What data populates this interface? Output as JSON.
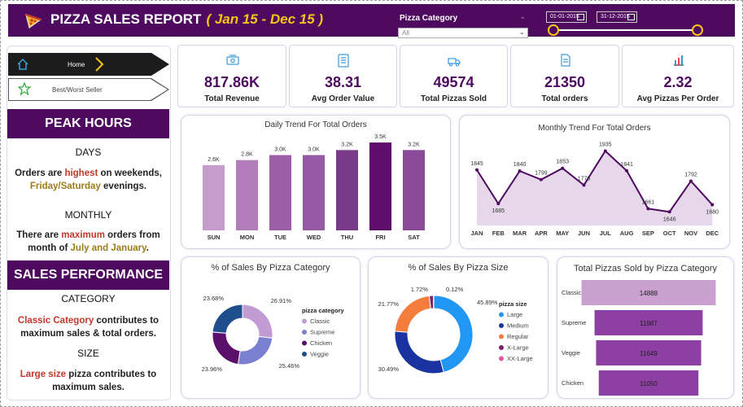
{
  "header": {
    "title": "PIZZA SALES REPORT",
    "range": "( Jan 15 - Dec 15 )",
    "filter_label": "Pizza Category",
    "filter_value": "All",
    "date_start": "01-01-2015",
    "date_end": "31-12-2015"
  },
  "nav": {
    "home": "Home",
    "best_worst": "Best/Worst Seller"
  },
  "peak": {
    "title": "PEAK HOURS",
    "days_title": "DAYS",
    "days_t1": "Orders are ",
    "days_hl": "highest",
    "days_t2": " on weekends,",
    "days_hl2": "Friday/Saturday",
    "days_t3": " evenings.",
    "month_title": "MONTHLY",
    "month_t1": "There are ",
    "month_hl": "maximum",
    "month_t2": " orders from",
    "month_t3": "month of ",
    "month_hl2": "July and January",
    "month_t4": "."
  },
  "sales": {
    "title": "SALES PERFORMANCE",
    "cat_title": "CATEGORY",
    "cat_hl": "Classic Category",
    "cat_t1": " contributes to",
    "cat_t2": "maximum sales & total orders.",
    "size_title": "SIZE",
    "size_hl": "Large size",
    "size_t1": " pizza contributes to",
    "size_t2": "maximum sales."
  },
  "kpis": [
    {
      "value": "817.86K",
      "label": "Total Revenue",
      "icon": "money-icon"
    },
    {
      "value": "38.31",
      "label": "Avg Order Value",
      "icon": "clipboard-icon"
    },
    {
      "value": "49574",
      "label": "Total Pizzas Sold",
      "icon": "delivery-icon"
    },
    {
      "value": "21350",
      "label": "Total orders",
      "icon": "document-icon"
    },
    {
      "value": "2.32",
      "label": "Avg Pizzas Per Order",
      "icon": "bar-chart-icon"
    }
  ],
  "colors": {
    "primary": "#4e0a5f",
    "accent": "#f5c518",
    "bar_colors": [
      "#c59ccb",
      "#b27cbb",
      "#9d5ea8",
      "#955aa3",
      "#7a3a8a",
      "#5e0f6d",
      "#8a4a97"
    ],
    "category_colors": [
      "#c39bd3",
      "#7b7fd0",
      "#5a0f6a",
      "#1f4e8c"
    ],
    "size_colors": [
      "#2196f3",
      "#1a33a0",
      "#f47c3c",
      "#7b1f6e",
      "#e056a5"
    ],
    "hbar_colors": [
      "#c9a0d0",
      "#8e3fa3",
      "#8e3fa3",
      "#8e3fa3"
    ]
  },
  "chart_data": [
    {
      "type": "bar",
      "title": "Daily Trend For Total Orders",
      "categories": [
        "SUN",
        "MON",
        "TUE",
        "WED",
        "THU",
        "FRI",
        "SAT"
      ],
      "values": [
        2.6,
        2.8,
        3.0,
        3.0,
        3.2,
        3.5,
        3.2
      ],
      "labels": [
        "2.6K",
        "2.8K",
        "3.0K",
        "3.0K",
        "3.2K",
        "3.5K",
        "3.2K"
      ],
      "ylim": [
        0,
        3.6
      ]
    },
    {
      "type": "area",
      "title": "Monthly Trend For Total Orders",
      "categories": [
        "JAN",
        "FEB",
        "MAR",
        "APR",
        "MAY",
        "JUN",
        "JUL",
        "AUG",
        "SEP",
        "OCT",
        "NOV",
        "DEC"
      ],
      "values": [
        1845,
        1685,
        1840,
        1799,
        1853,
        1773,
        1935,
        1841,
        1661,
        1646,
        1792,
        1680
      ],
      "ylim": [
        1620,
        1960
      ]
    },
    {
      "type": "pie",
      "title": "% of Sales By Pizza Category",
      "legend_title": "pizza category",
      "labels": [
        "Classic",
        "Supreme",
        "Chicken",
        "Veggie"
      ],
      "values": [
        26.91,
        25.46,
        23.96,
        23.68
      ],
      "value_labels": [
        "26.91%",
        "25.46%",
        "23.96%",
        "23.68%"
      ]
    },
    {
      "type": "pie",
      "title": "% of Sales By Pizza Size",
      "legend_title": "pizza size",
      "labels": [
        "Large",
        "Medium",
        "Regular",
        "X-Large",
        "XX-Large"
      ],
      "values": [
        45.89,
        30.49,
        21.77,
        1.72,
        0.12
      ],
      "value_labels": [
        "45.89%",
        "30.49%",
        "21.77%",
        "1.72%",
        "0.12%"
      ]
    },
    {
      "type": "bar",
      "title": "Total Pizzas Sold by Pizza Category",
      "categories": [
        "Classic",
        "Supreme",
        "Veggie",
        "Chicken"
      ],
      "values": [
        14888,
        11987,
        11649,
        11050
      ]
    }
  ]
}
